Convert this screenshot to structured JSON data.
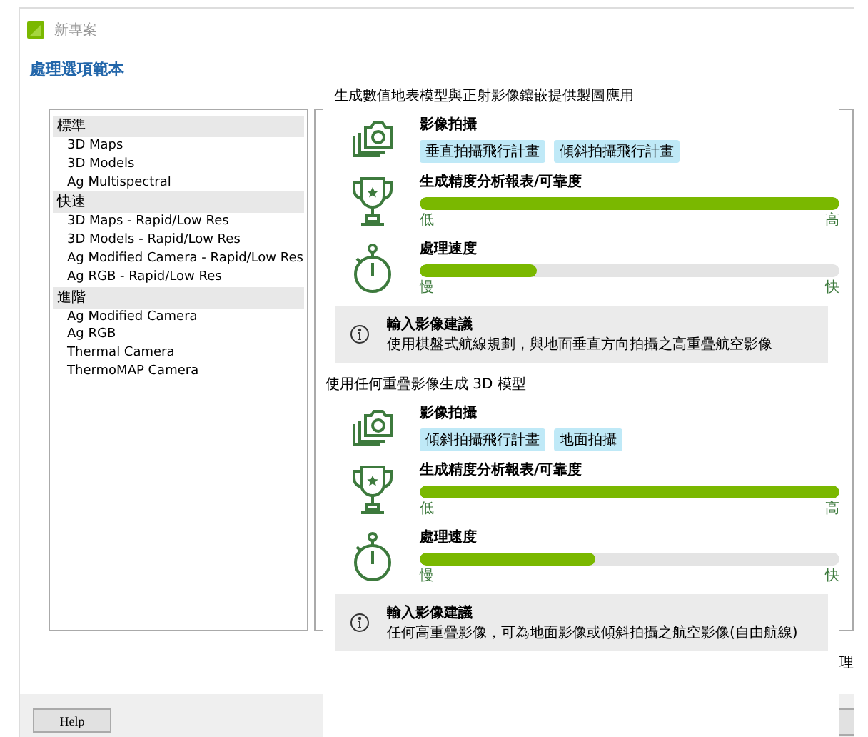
{
  "window": {
    "title": "新專案"
  },
  "heading": "處理選項範本",
  "template_groups": [
    {
      "title": "標準",
      "items": [
        "3D Maps",
        "3D Models",
        "Ag Multispectral"
      ]
    },
    {
      "title": "快速",
      "items": [
        "3D Maps - Rapid/Low Res",
        "3D Models - Rapid/Low Res",
        "Ag Modified Camera - Rapid/Low Res",
        "Ag RGB - Rapid/Low Res"
      ]
    },
    {
      "title": "進階",
      "items": [
        "Ag Modified Camera",
        "Ag RGB",
        "Thermal Camera",
        "ThermoMAP Camera"
      ]
    }
  ],
  "help_button": "Help",
  "partly_hidden_text": "理",
  "popup": {
    "sections": [
      {
        "title": "生成數值地表模型與正射影像鑲嵌提供製圖應用",
        "capture": {
          "label": "影像拍攝",
          "tags": [
            "垂直拍攝飛行計畫",
            "傾斜拍攝飛行計畫"
          ]
        },
        "accuracy": {
          "label": "生成精度分析報表/可靠度",
          "level": 1,
          "low": "低",
          "high": "高"
        },
        "speed": {
          "label": "處理速度",
          "level": 0.28,
          "low": "慢",
          "high": "快"
        },
        "advice": {
          "title": "輸入影像建議",
          "text": "使用棋盤式航線規劃，與地面垂直方向拍攝之高重疊航空影像"
        }
      },
      {
        "title": "使用任何重疊影像生成 3D 模型",
        "capture": {
          "label": "影像拍攝",
          "tags": [
            "傾斜拍攝飛行計畫",
            "地面拍攝"
          ]
        },
        "accuracy": {
          "label": "生成精度分析報表/可靠度",
          "level": 1,
          "low": "低",
          "high": "高"
        },
        "speed": {
          "label": "處理速度",
          "level": 0.42,
          "low": "慢",
          "high": "快"
        },
        "advice": {
          "title": "輸入影像建議",
          "text": "任何高重疊影像，可為地面影像或傾斜拍攝之航空影像(自由航線)"
        }
      }
    ]
  }
}
